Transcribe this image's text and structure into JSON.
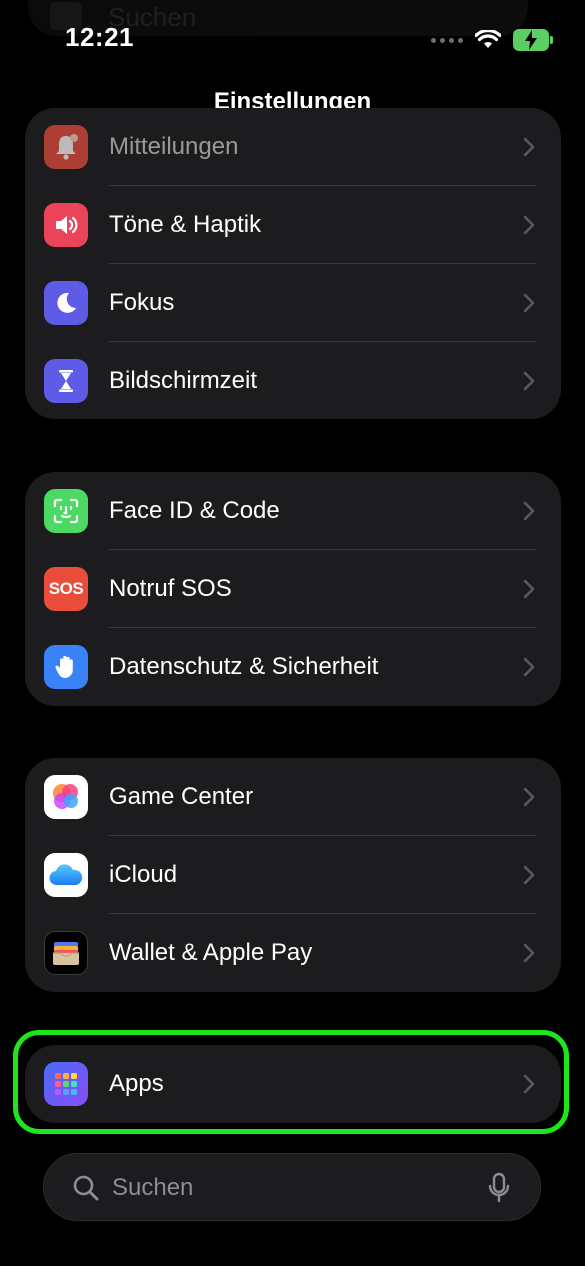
{
  "status": {
    "time": "12:21"
  },
  "ghost_search": {
    "text": "Suchen"
  },
  "header": {
    "title": "Einstellungen"
  },
  "groups": [
    {
      "items": [
        {
          "label": "Mitteilungen",
          "icon": "bell-icon",
          "color": "#eb4d3d"
        },
        {
          "label": "Töne & Haptik",
          "icon": "speaker-icon",
          "color": "#eb445a"
        },
        {
          "label": "Fokus",
          "icon": "moon-icon",
          "color": "#5e5ce6"
        },
        {
          "label": "Bildschirmzeit",
          "icon": "hourglass-icon",
          "color": "#5e5ce6"
        }
      ]
    },
    {
      "items": [
        {
          "label": "Face ID & Code",
          "icon": "face-id-icon",
          "color": "#4cd964"
        },
        {
          "label": "Notruf SOS",
          "icon": "sos-icon",
          "color": "#eb4d3d",
          "icon_text": "SOS"
        },
        {
          "label": "Datenschutz & Sicherheit",
          "icon": "hand-icon",
          "color": "#3a82f7"
        }
      ]
    },
    {
      "items": [
        {
          "label": "Game Center",
          "icon": "game-center-icon",
          "color": "#ffffff"
        },
        {
          "label": "iCloud",
          "icon": "cloud-icon",
          "color": "#ffffff"
        },
        {
          "label": "Wallet & Apple Pay",
          "icon": "wallet-icon",
          "color": "#1c1c1e"
        }
      ]
    },
    {
      "items": [
        {
          "label": "Apps",
          "icon": "apps-grid-icon",
          "color": "#6a5cf0"
        }
      ]
    }
  ],
  "search": {
    "placeholder": "Suchen"
  },
  "colors": {
    "highlight": "#1ee61a",
    "background": "#000000",
    "group": "#1c1c1e"
  }
}
